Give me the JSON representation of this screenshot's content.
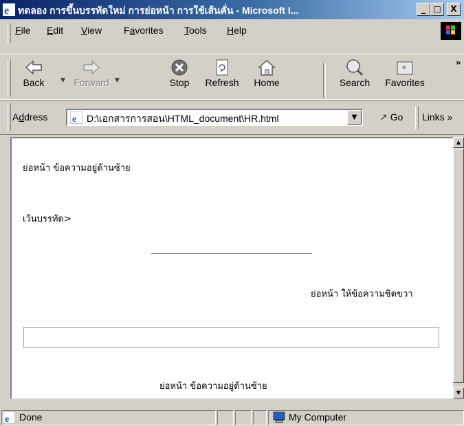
{
  "window": {
    "title": "ทดลอง การขึ้นบรรทัดใหม่ การย่อหน้า การใช้เส้นคั่น - Microsoft I...",
    "controls": {
      "minimize": "_",
      "maximize": "□",
      "close": "X"
    }
  },
  "menu": {
    "items": [
      {
        "label": "File",
        "accel": "F",
        "rest": "ile"
      },
      {
        "label": "Edit",
        "accel": "E",
        "rest": "dit"
      },
      {
        "label": "View",
        "accel": "V",
        "rest": "iew"
      },
      {
        "label": "Favorites",
        "pre": "F",
        "accel": "a",
        "rest": "vorites"
      },
      {
        "label": "Tools",
        "accel": "T",
        "rest": "ools"
      },
      {
        "label": "Help",
        "accel": "H",
        "rest": "elp"
      }
    ]
  },
  "toolbar": {
    "back": "Back",
    "forward": "Forward",
    "stop": "Stop",
    "refresh": "Refresh",
    "home": "Home",
    "search": "Search",
    "favorites": "Favorites",
    "more": "»"
  },
  "address": {
    "label_pre": "A",
    "label_accel": "d",
    "label_rest": "dress",
    "value": "D:\\เอกสารการสอน\\HTML_document\\HR.html",
    "go": "Go",
    "links": "Links »"
  },
  "page": {
    "line1": "ย่อหน้า ข้อความอยู่ด้านซ้าย",
    "line2": "เว้นบรรทัด>",
    "line3": "ย่อหน้า ให้ข้อความชิดขวา",
    "line4": "ย่อหน้า ข้อความอยู่ด้านซ้าย"
  },
  "status": {
    "text": "Done",
    "zone": "My Computer"
  }
}
